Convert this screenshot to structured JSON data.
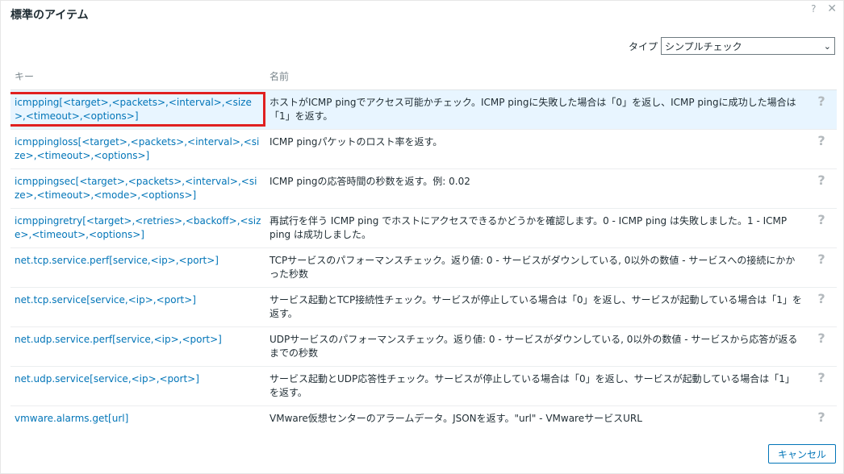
{
  "dialog": {
    "title": "標準のアイテム"
  },
  "header_icons": {
    "help": "?",
    "close": "✕"
  },
  "filter": {
    "label": "タイプ",
    "selected": "シンプルチェック"
  },
  "table": {
    "columns": {
      "key": "キー",
      "name": "名前"
    },
    "rows": [
      {
        "key": "icmpping[<target>,<packets>,<interval>,<size>,<timeout>,<options>]",
        "name": "ホストがICMP pingでアクセス可能かチェック。ICMP pingに失敗した場合は「0」を返し、ICMP pingに成功した場合は「1」を返す。"
      },
      {
        "key": "icmppingloss[<target>,<packets>,<interval>,<size>,<timeout>,<options>]",
        "name": "ICMP pingパケットのロスト率を返す。"
      },
      {
        "key": "icmppingsec[<target>,<packets>,<interval>,<size>,<timeout>,<mode>,<options>]",
        "name": "ICMP pingの応答時間の秒数を返す。例: 0.02"
      },
      {
        "key": "icmppingretry[<target>,<retries>,<backoff>,<size>,<timeout>,<options>]",
        "name": "再試行を伴う ICMP ping でホストにアクセスできるかどうかを確認します。0 - ICMP ping は失敗しました。1 - ICMP ping は成功しました。"
      },
      {
        "key": "net.tcp.service.perf[service,<ip>,<port>]",
        "name": "TCPサービスのパフォーマンスチェック。返り値: 0 - サービスがダウンしている, 0以外の数値 - サービスへの接続にかかった秒数"
      },
      {
        "key": "net.tcp.service[service,<ip>,<port>]",
        "name": "サービス起動とTCP接続性チェック。サービスが停止している場合は「0」を返し、サービスが起動している場合は「1」を返す。"
      },
      {
        "key": "net.udp.service.perf[service,<ip>,<port>]",
        "name": "UDPサービスのパフォーマンスチェック。返り値: 0 - サービスがダウンしている, 0以外の数値 - サービスから応答が返るまでの秒数"
      },
      {
        "key": "net.udp.service[service,<ip>,<port>]",
        "name": "サービス起動とUDP応答性チェック。サービスが停止している場合は「0」を返し、サービスが起動している場合は「1」を返す。"
      },
      {
        "key": "vmware.alarms.get[url]",
        "name": "VMware仮想センターのアラームデータ。JSONを返す。\"url\" - VMwareサービスURL"
      }
    ],
    "help_glyph": "?"
  },
  "footer": {
    "cancel_label": "キャンセル"
  },
  "colors": {
    "link": "#0275b8",
    "selected_row": "#e8f5ff",
    "highlight": "#e02020"
  }
}
